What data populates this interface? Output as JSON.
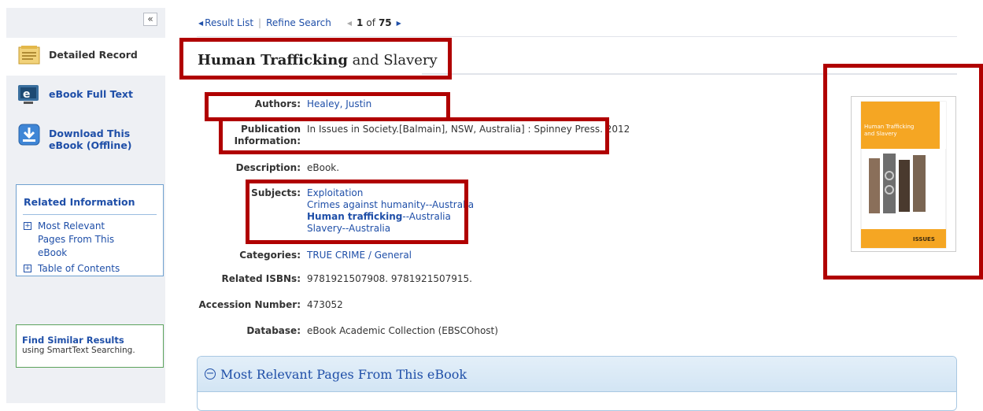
{
  "sidebar": {
    "collapse_label": "«",
    "items": [
      {
        "label": "Detailed Record",
        "icon": "detailed-record-icon"
      },
      {
        "label": "eBook Full Text",
        "icon": "ebook-icon"
      },
      {
        "label": "Download This eBook (Offline)",
        "icon": "download-icon"
      }
    ],
    "related": {
      "title": "Related Information",
      "items": [
        "Most Relevant Pages From This eBook",
        "Table of Contents"
      ]
    },
    "similar": {
      "title": "Find Similar Results",
      "subtitle": "using SmartText Searching."
    }
  },
  "nav": {
    "result_list": "Result List",
    "refine_search": "Refine Search",
    "current": "1",
    "of_text": "of",
    "total": "75"
  },
  "record": {
    "title_bold": "Human Trafficking",
    "title_rest": " and Slavery",
    "fields": {
      "authors_label": "Authors:",
      "authors_value": "Healey, Justin",
      "pubinfo_label_1": "Publication",
      "pubinfo_label_2": "Information:",
      "pubinfo_value": "In Issues in Society.[Balmain], NSW, Australia] : Spinney Press. 2012",
      "description_label": "Description:",
      "description_value": "eBook.",
      "subjects_label": "Subjects:",
      "subjects": {
        "s1": "Exploitation",
        "s2": "Crimes against humanity--Australia",
        "s3_bold": "Human trafficking",
        "s3_rest": "--Australia",
        "s4": "Slavery--Australia"
      },
      "categories_label": "Categories:",
      "categories_value": "TRUE CRIME / General",
      "isbn_label": "Related ISBNs:",
      "isbn_value": "9781921507908. 9781921507915.",
      "accession_label": "Accession Number:",
      "accession_value": "473052",
      "database_label": "Database:",
      "database_value": "eBook Academic Collection (EBSCOhost)"
    }
  },
  "cover": {
    "title_line1": "Human Trafficking",
    "title_line2": "and Slavery",
    "brand": "ISSUES",
    "colors": {
      "orange": "#f5a623",
      "highlight": "#b00000"
    }
  },
  "panel": {
    "toggle": "−",
    "title": "Most Relevant Pages From This eBook"
  },
  "colors": {
    "link": "#1f4fa8",
    "highlight_box": "#b00000",
    "sidebar_bg": "#eef0f4"
  }
}
